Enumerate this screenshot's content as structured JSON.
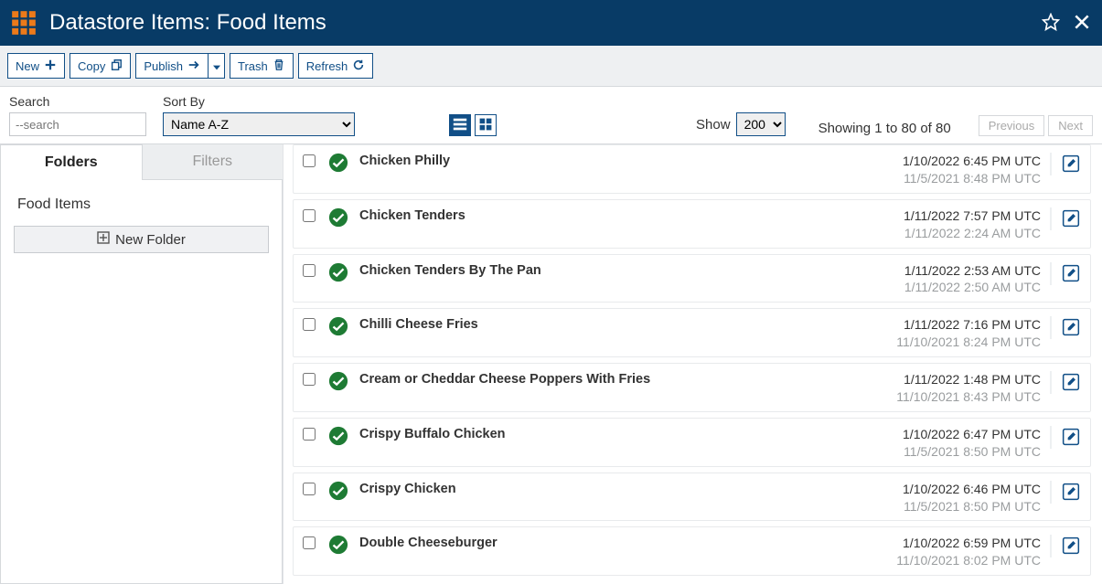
{
  "header": {
    "title": "Datastore Items: Food Items"
  },
  "toolbar": {
    "new_label": "New",
    "copy_label": "Copy",
    "publish_label": "Publish",
    "trash_label": "Trash",
    "refresh_label": "Refresh"
  },
  "filter": {
    "search_label": "Search",
    "search_placeholder": "--search",
    "sort_label": "Sort By",
    "sort_value": "Name A-Z",
    "show_label": "Show",
    "show_value": "200",
    "summary": "Showing 1 to 80 of 80",
    "prev_label": "Previous",
    "next_label": "Next"
  },
  "sidebar": {
    "tab_folders": "Folders",
    "tab_filters": "Filters",
    "folder_label": "Food Items",
    "new_folder_label": "New Folder"
  },
  "rows": [
    {
      "name": "Chicken Philly",
      "d1": "1/10/2022 6:45 PM UTC",
      "d2": "11/5/2021 8:48 PM UTC"
    },
    {
      "name": "Chicken Tenders",
      "d1": "1/11/2022 7:57 PM UTC",
      "d2": "1/11/2022 2:24 AM UTC"
    },
    {
      "name": "Chicken Tenders By The Pan",
      "d1": "1/11/2022 2:53 AM UTC",
      "d2": "1/11/2022 2:50 AM UTC"
    },
    {
      "name": "Chilli Cheese Fries",
      "d1": "1/11/2022 7:16 PM UTC",
      "d2": "11/10/2021 8:24 PM UTC"
    },
    {
      "name": "Cream or Cheddar Cheese Poppers With Fries",
      "d1": "1/11/2022 1:48 PM UTC",
      "d2": "11/10/2021 8:43 PM UTC"
    },
    {
      "name": "Crispy Buffalo Chicken",
      "d1": "1/10/2022 6:47 PM UTC",
      "d2": "11/5/2021 8:50 PM UTC"
    },
    {
      "name": "Crispy Chicken",
      "d1": "1/10/2022 6:46 PM UTC",
      "d2": "11/5/2021 8:50 PM UTC"
    },
    {
      "name": "Double Cheeseburger",
      "d1": "1/10/2022 6:59 PM UTC",
      "d2": "11/10/2021 8:02 PM UTC"
    }
  ],
  "colors": {
    "primary": "#114f87",
    "header_bg": "#083b66",
    "ok_green": "#1e7b34"
  }
}
